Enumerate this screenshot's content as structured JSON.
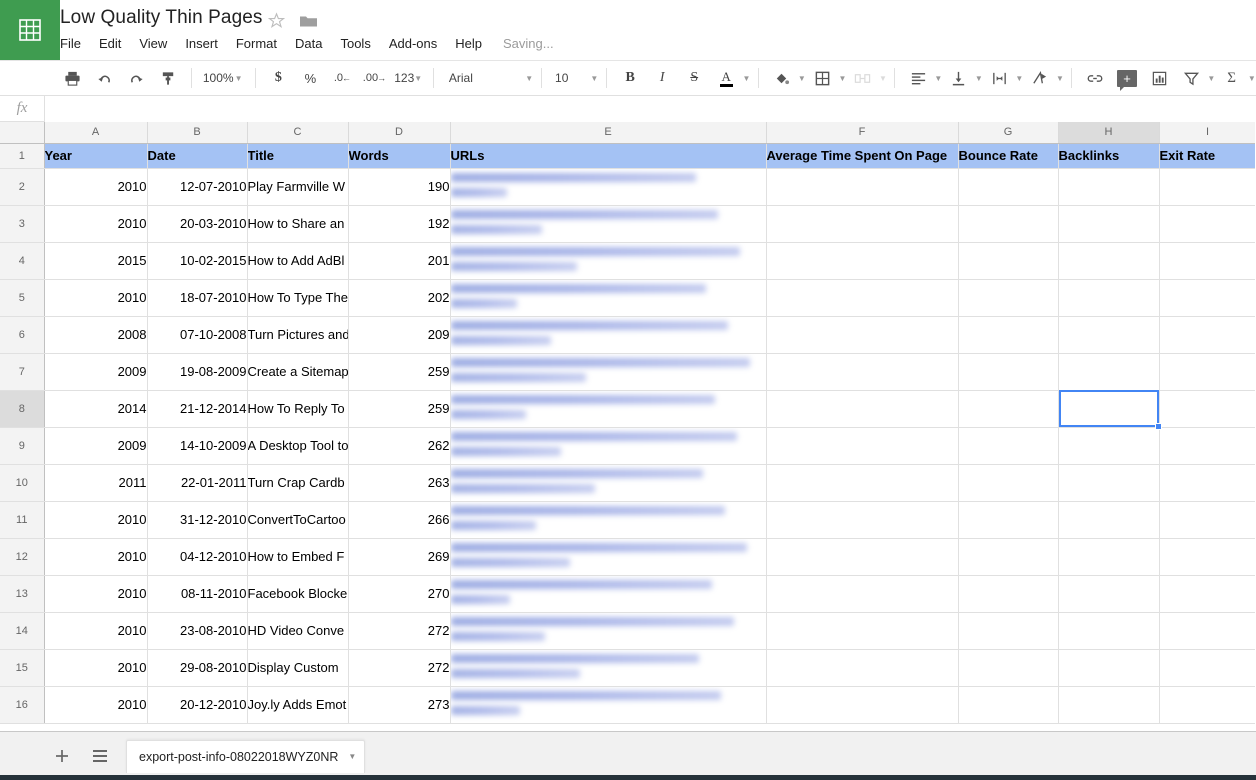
{
  "app": {
    "logo_icon": "sheets-grid-icon",
    "title": "Low Quality Thin Pages",
    "star_icon": "star-icon",
    "folder_icon": "folder-icon",
    "saving_status": "Saving...",
    "menus": [
      "File",
      "Edit",
      "View",
      "Insert",
      "Format",
      "Data",
      "Tools",
      "Add-ons",
      "Help"
    ]
  },
  "toolbar": {
    "print_icon": "print-icon",
    "undo_icon": "undo-icon",
    "redo_icon": "redo-icon",
    "paint_format_icon": "paint-format-icon",
    "zoom_value": "100%",
    "currency_label": "$",
    "percent_label": "%",
    "decrease_decimal_label": ".0",
    "increase_decimal_label": ".00",
    "more_formats_label": "123",
    "font_family_value": "Arial",
    "font_size_value": "10",
    "bold_label": "B",
    "italic_label": "I",
    "strikethrough_label": "S",
    "text_color_label": "A",
    "fill_color_icon": "fill-color-icon",
    "borders_icon": "borders-icon",
    "merge_cells_icon": "merge-cells-icon",
    "horizontal_align_icon": "horizontal-align-icon",
    "vertical_align_icon": "vertical-align-icon",
    "text_wrap_icon": "text-wrap-icon",
    "text_rotation_icon": "text-rotation-icon",
    "insert_link_icon": "insert-link-icon",
    "insert_comment_icon": "insert-comment-icon",
    "insert_chart_icon": "insert-chart-icon",
    "filter_icon": "filter-icon",
    "functions_label": "Σ"
  },
  "formula_bar": {
    "fx_label": "fx",
    "value": "",
    "placeholder": ""
  },
  "grid": {
    "column_letters": [
      "A",
      "B",
      "C",
      "D",
      "E",
      "F",
      "G",
      "H",
      "I"
    ],
    "selected_column": "H",
    "selected_row": "8",
    "selected_cell": "H8",
    "selection_color": "#4285f4",
    "header_fill_color": "#a4c2f4",
    "headers": [
      "Year",
      "Date",
      "Title",
      "Words",
      "URLs",
      "Average Time Spent On Page",
      "Bounce Rate",
      "Backlinks",
      "Exit Rate"
    ],
    "row_numbers": [
      "1",
      "2",
      "3",
      "4",
      "5",
      "6",
      "7",
      "8",
      "9",
      "10",
      "11",
      "12",
      "13",
      "14",
      "15",
      "16"
    ],
    "rows": [
      {
        "row": "2",
        "year": "2010",
        "date": "12-07-2010",
        "title": "Play Farmville W",
        "words": "190",
        "url_redacted": true,
        "avg_time": "",
        "bounce_rate": "",
        "backlinks": "",
        "exit_rate": ""
      },
      {
        "row": "3",
        "year": "2010",
        "date": "20-03-2010",
        "title": "How to Share an",
        "words": "192",
        "url_redacted": true,
        "avg_time": "",
        "bounce_rate": "",
        "backlinks": "",
        "exit_rate": ""
      },
      {
        "row": "4",
        "year": "2015",
        "date": "10-02-2015",
        "title": "How to Add AdBl",
        "words": "201",
        "url_redacted": true,
        "avg_time": "",
        "bounce_rate": "",
        "backlinks": "",
        "exit_rate": ""
      },
      {
        "row": "5",
        "year": "2010",
        "date": "18-07-2010",
        "title": "How To Type The",
        "words": "202",
        "url_redacted": true,
        "avg_time": "",
        "bounce_rate": "",
        "backlinks": "",
        "exit_rate": ""
      },
      {
        "row": "6",
        "year": "2008",
        "date": "07-10-2008",
        "title": "Turn Pictures and",
        "words": "209",
        "url_redacted": true,
        "avg_time": "",
        "bounce_rate": "",
        "backlinks": "",
        "exit_rate": ""
      },
      {
        "row": "7",
        "year": "2009",
        "date": "19-08-2009",
        "title": "Create a Sitemap",
        "words": "259",
        "url_redacted": true,
        "avg_time": "",
        "bounce_rate": "",
        "backlinks": "",
        "exit_rate": ""
      },
      {
        "row": "8",
        "year": "2014",
        "date": "21-12-2014",
        "title": "How To Reply To",
        "words": "259",
        "url_redacted": true,
        "avg_time": "",
        "bounce_rate": "",
        "backlinks": "",
        "exit_rate": ""
      },
      {
        "row": "9",
        "year": "2009",
        "date": "14-10-2009",
        "title": "A Desktop Tool to",
        "words": "262",
        "url_redacted": true,
        "avg_time": "",
        "bounce_rate": "",
        "backlinks": "",
        "exit_rate": ""
      },
      {
        "row": "10",
        "year": "2011",
        "date": "22-01-2011",
        "title": "Turn Crap Cardb",
        "words": "263",
        "url_redacted": true,
        "avg_time": "",
        "bounce_rate": "",
        "backlinks": "",
        "exit_rate": ""
      },
      {
        "row": "11",
        "year": "2010",
        "date": "31-12-2010",
        "title": "ConvertToCartoo",
        "words": "266",
        "url_redacted": true,
        "avg_time": "",
        "bounce_rate": "",
        "backlinks": "",
        "exit_rate": ""
      },
      {
        "row": "12",
        "year": "2010",
        "date": "04-12-2010",
        "title": "How to Embed F",
        "words": "269",
        "url_redacted": true,
        "avg_time": "",
        "bounce_rate": "",
        "backlinks": "",
        "exit_rate": ""
      },
      {
        "row": "13",
        "year": "2010",
        "date": "08-11-2010",
        "title": "Facebook Blocke",
        "words": "270",
        "url_redacted": true,
        "avg_time": "",
        "bounce_rate": "",
        "backlinks": "",
        "exit_rate": ""
      },
      {
        "row": "14",
        "year": "2010",
        "date": "23-08-2010",
        "title": "HD Video Conve",
        "words": "272",
        "url_redacted": true,
        "avg_time": "",
        "bounce_rate": "",
        "backlinks": "",
        "exit_rate": ""
      },
      {
        "row": "15",
        "year": "2010",
        "date": "29-08-2010",
        "title": "Display Custom ",
        "words": "272",
        "url_redacted": true,
        "avg_time": "",
        "bounce_rate": "",
        "backlinks": "",
        "exit_rate": ""
      },
      {
        "row": "16",
        "year": "2010",
        "date": "20-12-2010",
        "title": "Joy.ly Adds Emot",
        "words": "273",
        "url_redacted": true,
        "avg_time": "",
        "bounce_rate": "",
        "backlinks": "",
        "exit_rate": ""
      }
    ]
  },
  "bottom": {
    "add_sheet_icon": "plus-icon",
    "all_sheets_icon": "sheet-list-icon",
    "sheet_tab_name": "export-post-info-08022018WYZ0NR",
    "sheet_tab_caret_icon": "chevron-down-icon"
  }
}
